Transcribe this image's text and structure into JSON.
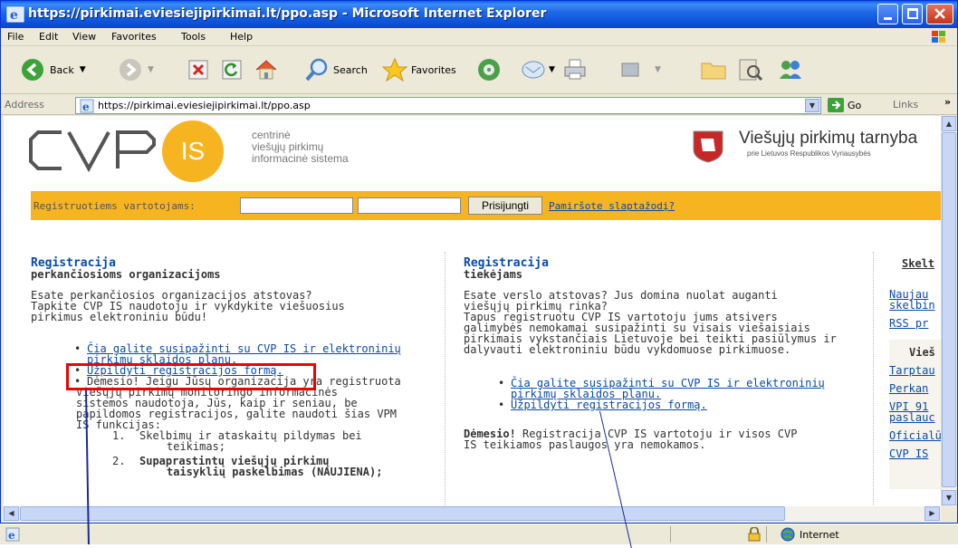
{
  "window": {
    "title": "https://pirkimai.eviesiejipirkimai.lt/ppo.asp - Microsoft Internet Explorer"
  },
  "menu": [
    "File",
    "Edit",
    "View",
    "Favorites",
    "Tools",
    "Help"
  ],
  "toolbar": {
    "back_label": "Back",
    "search_label": "Search",
    "favorites_label": "Favorites"
  },
  "address": {
    "label": "Address",
    "url": "https://pirkimai.eviesiejipirkimai.lt/ppo.asp",
    "go_label": "Go",
    "links_label": "Links"
  },
  "header": {
    "logo_left_text": "CVP",
    "logo_is_text": "IS",
    "logo_sub_lines": [
      "centrinė",
      "viešųjų pirkimų",
      "informacinė sistema"
    ],
    "agency_title": "Viešųjų pirkimų tarnyba",
    "agency_sub": "prie Lietuvos Respublikos Vyriausybės"
  },
  "login": {
    "label": "Registruotiems vartotojams:",
    "button": "Prisijungti",
    "forgot": "Pamiršote slaptažodį?"
  },
  "left": {
    "title": "Registracija",
    "subtitle": "perkančiosioms organizacijoms",
    "intro_lines": [
      "Esate perkančiosios organizacijos atstovas?",
      "Tapkite CVP IS naudotoju ir vykdykite viešuosius",
      "pirkimus elektroniniu būdu!"
    ],
    "link1_line1": "Čia galite susipažinti su CVP IS ir elektroninių",
    "link1_line2": "pirkimų sklaidos planu.",
    "link2": "Užpildyti registracijos formą.",
    "notice_prefix": "Dėmesio! Jeigu Jūsų organizacija yra registruota",
    "notice_lines": [
      "Viešųjų pirkimų monitoringo informacinės",
      "sistemos naudotoja, Jūs, kaip ir seniau, be",
      "papildomos registracijos, galite naudoti šias VPM",
      "IS funkcijas:"
    ],
    "list": [
      {
        "num": "1.",
        "l1": "Skelbimų ir ataskaitų pildymas bei",
        "l2": "teikimas;"
      },
      {
        "num": "2.",
        "l1": "Supaprastintų viešųjų pirkimų",
        "l2": "taisyklių paskelbimas (NAUJIENA);"
      }
    ]
  },
  "middle": {
    "title": "Registracija",
    "subtitle": "tiekėjams",
    "intro_lines": [
      "Esate verslo atstovas? Jus domina nuolat auganti",
      "viešųjų pirkimų rinka?",
      "Tapus registruotu CVP IS vartotoju jums atsivers",
      "galimybės nemokamai susipažinti su visais viešaisiais",
      "pirkimais vykstančiais Lietuvoje bei teikti pasiūlymus ir",
      "dalyvauti elektroniniu būdu vykdomuose pirkimuose."
    ],
    "link1_line1": "Čia galite susipažinti su CVP IS ir elektroninių",
    "link1_line2": "pirkimų sklaidos planu.",
    "link2": "Užpildyti registracijos formą.",
    "notice_bold": "Dėmesio!",
    "notice_rest": " Registracija CVP IS vartotoju ir visos CVP",
    "notice_line2": "IS teikiamos paslaugos yra nemokamos."
  },
  "right": {
    "title": "Skelt",
    "links1": [
      "Naujau",
      "skelbin",
      "RSS pr"
    ],
    "box_title": "Vieš",
    "links2": [
      "Tarptau",
      "Perkan",
      "VPI 91",
      "paslauc",
      "Oficialū",
      "CVP IS"
    ]
  },
  "status": {
    "zone": "Internet"
  },
  "colors": {
    "accent": "#f6b420",
    "link": "#0a4aa8",
    "highlight": "#e00000"
  }
}
